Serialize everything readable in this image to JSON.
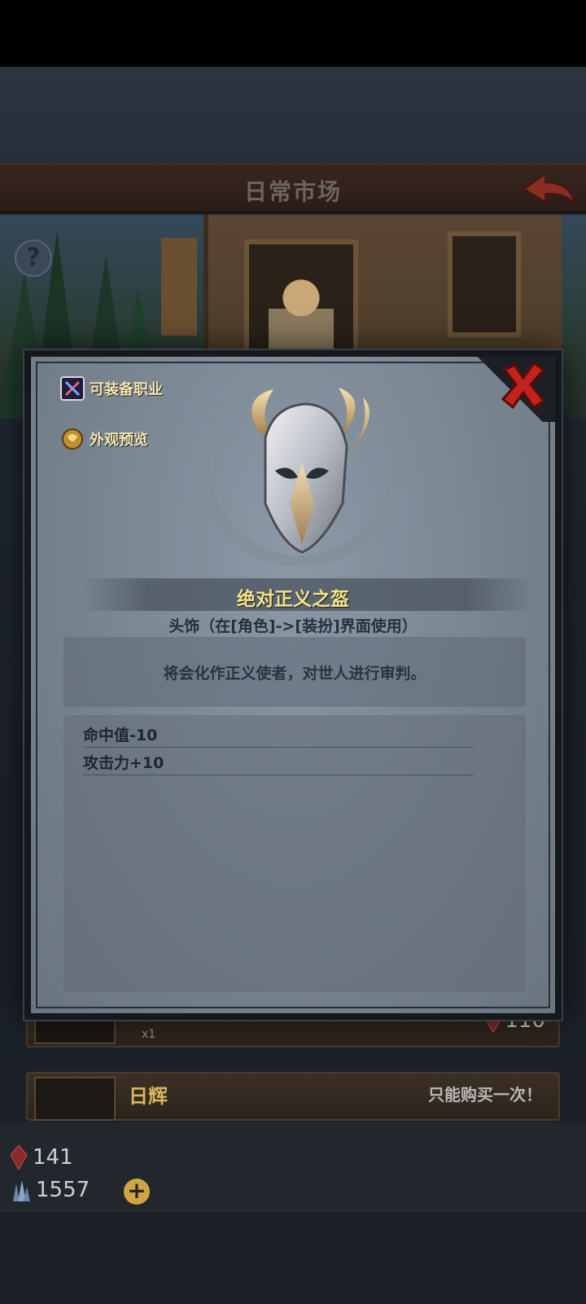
{
  "header": {
    "title": "日常市场"
  },
  "scene": {
    "help_icon": "?"
  },
  "rows": [
    {
      "count": "x1",
      "price": "110"
    },
    {
      "name": "日辉",
      "note": "只能购买一次！"
    }
  ],
  "currency": [
    {
      "icon": "red-gem-icon",
      "value": "141"
    },
    {
      "icon": "blue-crystal-icon",
      "value": "1557"
    }
  ],
  "plus_label": "+",
  "modal": {
    "side_buttons": [
      {
        "label": "可装备职业",
        "icon": "class-equip-icon"
      },
      {
        "label": "外观预览",
        "icon": "appearance-preview-icon"
      }
    ],
    "item_name": "绝对正义之盔",
    "item_type": "头饰（在[角色]->[装扮]界面使用）",
    "description": "将会化作正义使者，对世人进行审判。",
    "stats": [
      "命中值-10",
      "攻击力+10"
    ]
  }
}
